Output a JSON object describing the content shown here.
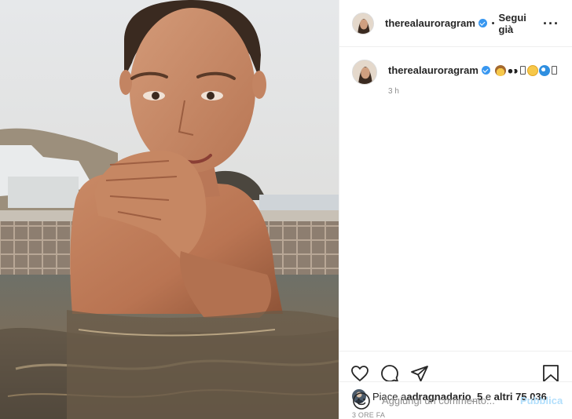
{
  "header": {
    "username": "therealauroragram",
    "separator": "•",
    "follow_status": "Segui già",
    "more_glyph": "···"
  },
  "caption": {
    "username": "therealauroragram",
    "emoji_icons": [
      "cowboy-face",
      "eyes",
      "missing-glyph",
      "slightly-smiling-face",
      "wave",
      "missing-glyph"
    ],
    "time": "3 h"
  },
  "actions": {
    "icons": [
      "heart-icon",
      "comment-icon",
      "share-icon",
      "bookmark-icon"
    ]
  },
  "likes": {
    "prefix": "Piace a ",
    "user": "adragnadario_5",
    "middle": " e ",
    "others": "altri 75.036"
  },
  "post_time": "3 ORE FA",
  "comment_box": {
    "placeholder": "Aggiungi un commento...",
    "publish_label": "Pubblica"
  },
  "colors": {
    "verified": "#3897f0",
    "publish_disabled": "#b2dffc",
    "muted_text": "#8e8e8e",
    "divider": "#efefef"
  }
}
